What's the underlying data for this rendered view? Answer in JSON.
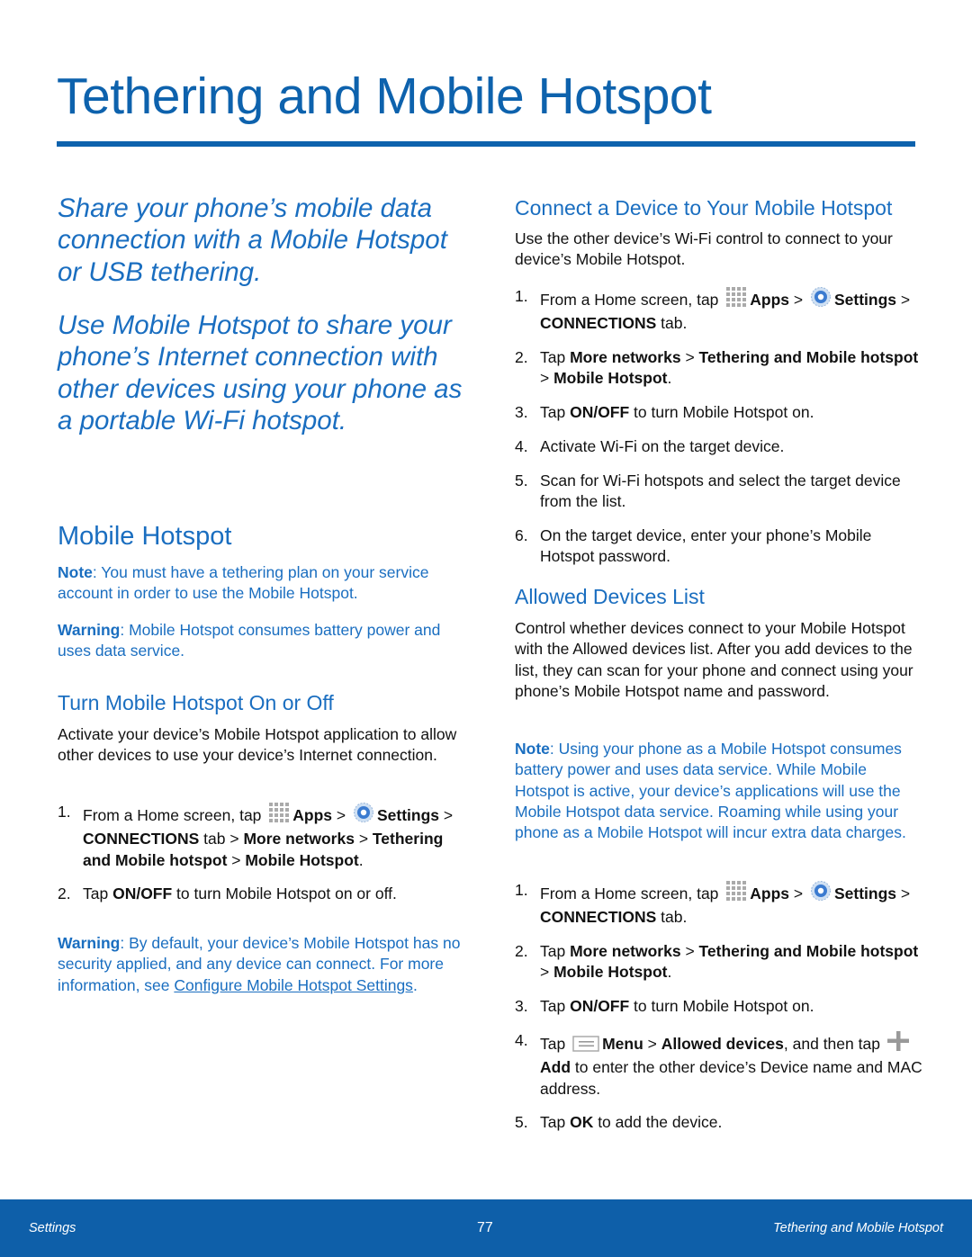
{
  "page_title": "Tethering and Mobile Hotspot",
  "colors": {
    "accent": "#0d62ad",
    "text_blue": "#1a6ec0",
    "footer": "#0e5fa9"
  },
  "left": {
    "intro1": [
      {
        "t": "Share your phone’s mobile data connection with a Mobile Hotspot or USB tethering."
      }
    ],
    "intro2": [
      {
        "t": "Use Mobile Hotspot to share your phone’s Internet connection with other devices using your phone as a portable Wi-Fi hotspot."
      }
    ],
    "h2": [
      {
        "t": "Mobile Hotspot"
      }
    ],
    "note": [
      {
        "t": "Note",
        "b": true
      },
      {
        "t": ": You must have a tethering plan on your service account in order to use the Mobile Hotspot."
      }
    ],
    "warning": [
      {
        "t": "Warning",
        "b": true
      },
      {
        "t": ": Mobile Hotspot consumes battery power and uses data service."
      }
    ],
    "h3": [
      {
        "t": "Turn Mobile Hotspot On or Off"
      }
    ],
    "body": [
      {
        "t": "Activate your device’s Mobile Hotspot application to allow other devices to use your device’s Internet connection."
      }
    ],
    "steps": [
      [
        {
          "t": "From a Home screen, tap "
        },
        {
          "icon": "apps-grid"
        },
        {
          "t": "Apps",
          "b": true
        },
        {
          "t": " > "
        },
        {
          "icon": "settings-gear"
        },
        {
          "t": "Settings",
          "b": true
        },
        {
          "t": " > "
        },
        {
          "t": "CONNECTIONS",
          "b": true
        },
        {
          "t": " tab > "
        },
        {
          "t": "More networks",
          "b": true
        },
        {
          "t": " > "
        },
        {
          "t": "Tethering and Mobile hotspot",
          "b": true
        },
        {
          "t": " > "
        },
        {
          "t": "Mobile Hotspot",
          "b": true
        },
        {
          "t": "."
        }
      ],
      [
        {
          "t": "Tap "
        },
        {
          "t": "ON/OFF",
          "b": true
        },
        {
          "t": " to turn Mobile Hotspot on or off."
        }
      ]
    ],
    "warning2": [
      {
        "t": "Warning",
        "b": true
      },
      {
        "t": ": By default, your device’s Mobile Hotspot has no security applied, and any device can connect. For more information, see "
      },
      {
        "t": "Configure Mobile Hotspot Settings",
        "link": true
      },
      {
        "t": "."
      }
    ]
  },
  "right": {
    "h3a": [
      {
        "t": "Connect a Device to Your Mobile Hotspot"
      }
    ],
    "body1": [
      {
        "t": "Use the other device’s Wi-Fi control to connect to your device’s Mobile Hotspot."
      }
    ],
    "steps1": [
      [
        {
          "t": "From a Home screen, tap "
        },
        {
          "icon": "apps-grid"
        },
        {
          "t": "Apps",
          "b": true
        },
        {
          "t": " > "
        },
        {
          "icon": "settings-gear"
        },
        {
          "t": "Settings",
          "b": true
        },
        {
          "t": " > "
        },
        {
          "t": "CONNECTIONS",
          "b": true
        },
        {
          "t": " tab."
        }
      ],
      [
        {
          "t": "Tap "
        },
        {
          "t": "More networks",
          "b": true
        },
        {
          "t": " > "
        },
        {
          "t": "Tethering and Mobile hotspot",
          "b": true
        },
        {
          "t": " > "
        },
        {
          "t": "Mobile Hotspot",
          "b": true
        },
        {
          "t": "."
        }
      ],
      [
        {
          "t": "Tap "
        },
        {
          "t": "ON/OFF",
          "b": true
        },
        {
          "t": " to turn Mobile Hotspot on."
        }
      ],
      [
        {
          "t": "Activate Wi-Fi on the target device."
        }
      ],
      [
        {
          "t": "Scan for Wi-Fi hotspots and select the target device from the list."
        }
      ],
      [
        {
          "t": "On the target device, enter your phone’s Mobile Hotspot password."
        }
      ]
    ],
    "h3b": [
      {
        "t": "Allowed Devices List"
      }
    ],
    "body2": [
      {
        "t": "Control whether devices connect to your Mobile Hotspot with the Allowed devices list. After you add devices to the list, they can scan for your phone and connect using your phone’s Mobile Hotspot name and password."
      }
    ],
    "note": [
      {
        "t": "Note",
        "b": true
      },
      {
        "t": ": Using your phone as a Mobile Hotspot consumes battery power and uses data service. While Mobile Hotspot is active, your device’s applications will use the Mobile Hotspot data service. Roaming while using your phone as a Mobile Hotspot will incur extra data charges."
      }
    ],
    "steps2": [
      [
        {
          "t": "From a Home screen, tap "
        },
        {
          "icon": "apps-grid"
        },
        {
          "t": "Apps",
          "b": true
        },
        {
          "t": " > "
        },
        {
          "icon": "settings-gear"
        },
        {
          "t": "Settings",
          "b": true
        },
        {
          "t": " > "
        },
        {
          "t": "CONNECTIONS",
          "b": true
        },
        {
          "t": " tab."
        }
      ],
      [
        {
          "t": "Tap "
        },
        {
          "t": "More networks",
          "b": true
        },
        {
          "t": " > "
        },
        {
          "t": "Tethering and Mobile hotspot",
          "b": true
        },
        {
          "t": " > "
        },
        {
          "t": "Mobile Hotspot",
          "b": true
        },
        {
          "t": "."
        }
      ],
      [
        {
          "t": "Tap "
        },
        {
          "t": "ON/OFF",
          "b": true
        },
        {
          "t": " to turn Mobile Hotspot on."
        }
      ],
      [
        {
          "t": "Tap "
        },
        {
          "icon": "menu"
        },
        {
          "t": "Menu",
          "b": true
        },
        {
          "t": " > "
        },
        {
          "t": "Allowed devices",
          "b": true
        },
        {
          "t": ", and then tap "
        },
        {
          "icon": "plus"
        },
        {
          "t": "Add",
          "b": true
        },
        {
          "t": " to enter the other device’s Device name and MAC address."
        }
      ],
      [
        {
          "t": "Tap "
        },
        {
          "t": "OK",
          "b": true
        },
        {
          "t": " to add the device."
        }
      ]
    ]
  },
  "footer": {
    "left": "Settings",
    "page": "77",
    "right": "Tethering and Mobile Hotspot"
  }
}
